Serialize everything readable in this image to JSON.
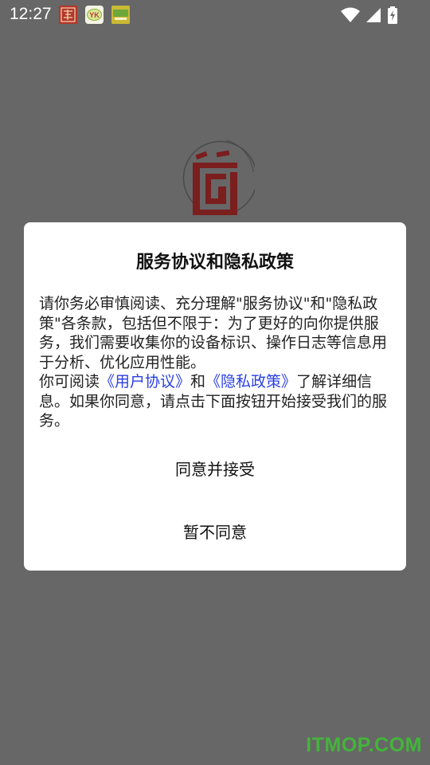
{
  "status_bar": {
    "time": "12:27",
    "notification_icons": [
      "calligraphy-app-icon",
      "yk-app-icon",
      "green-app-icon"
    ],
    "system_icons": [
      "wifi-icon",
      "signal-icon",
      "battery-charging-icon"
    ]
  },
  "dialog": {
    "title": "服务协议和隐私政策",
    "body_para1": "请你务必审慎阅读、充分理解\"服务协议\"和\"隐私政策\"各条款，包括但不限于：为了更好的向你提供服务，我们需要收集你的设备标识、操作日志等信息用于分析、优化应用性能。",
    "body_para2_prefix": "你可阅读",
    "user_agreement_link": "《用户协议》",
    "body_para2_and": "和",
    "privacy_policy_link": "《隐私政策》",
    "body_para2_suffix": "了解详细信息。如果你同意，请点击下面按钮开始接受我们的服务。",
    "agree_button": "同意并接受",
    "decline_button": "暂不同意"
  },
  "watermark": "ITMOP.COM",
  "colors": {
    "overlay": "#676767",
    "link": "#2a3fe0",
    "logo_red": "#7a1e1e",
    "watermark": "#43b53a"
  }
}
